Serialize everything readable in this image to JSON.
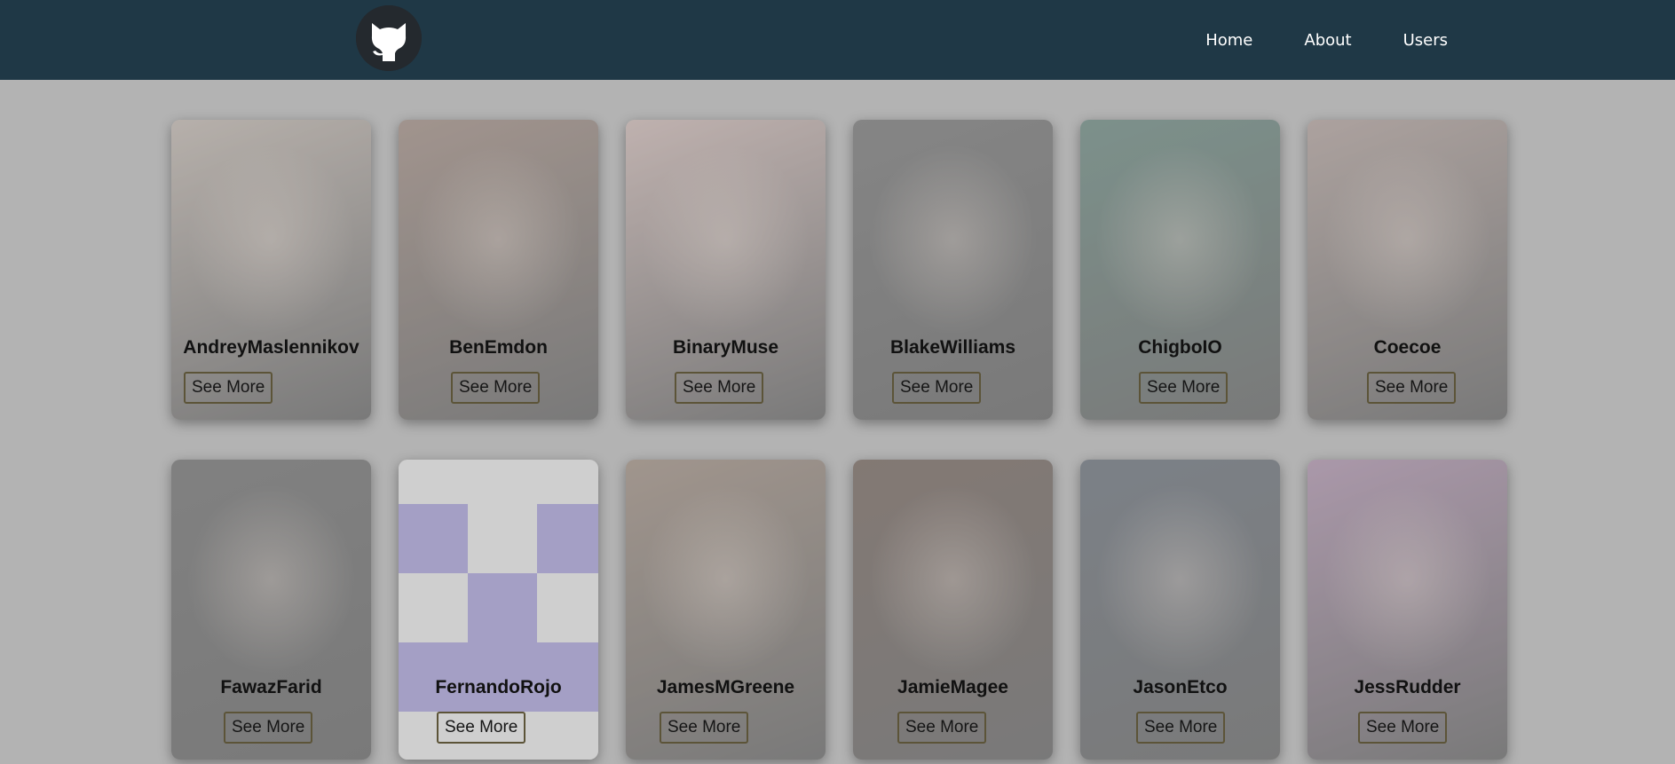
{
  "navbar": {
    "logo_icon": "github-octocat-icon",
    "links": [
      "Home",
      "About",
      "Users"
    ]
  },
  "users": [
    {
      "login": "AndreyMaslennikov",
      "button": "See More",
      "avatar": "photo",
      "tone": "#c9bfb7"
    },
    {
      "login": "BenEmdon",
      "button": "See More",
      "avatar": "photo",
      "tone": "#a8948a"
    },
    {
      "login": "BinaryMuse",
      "button": "See More",
      "avatar": "illustration",
      "tone": "#d6c1bd"
    },
    {
      "login": "BlakeWilliams",
      "button": "See More",
      "avatar": "photo",
      "tone": "#7d7d7d"
    },
    {
      "login": "ChigboIO",
      "button": "See More",
      "avatar": "photo",
      "tone": "#6f8f86"
    },
    {
      "login": "Coecoe",
      "button": "See More",
      "avatar": "photo",
      "tone": "#b9a9a4"
    },
    {
      "login": "FawazFarid",
      "button": "See More",
      "avatar": "photo",
      "tone": "#767676"
    },
    {
      "login": "FernandoRojo",
      "button": "See More",
      "avatar": "identicon",
      "tone": "#a49fc5"
    },
    {
      "login": "JamesMGreene",
      "button": "See More",
      "avatar": "photo",
      "tone": "#a79689"
    },
    {
      "login": "JamieMagee",
      "button": "See More",
      "avatar": "photo",
      "tone": "#7a6a62"
    },
    {
      "login": "JasonEtco",
      "button": "See More",
      "avatar": "photo",
      "tone": "#6e7680"
    },
    {
      "login": "JessRudder",
      "button": "See More",
      "avatar": "photo",
      "tone": "#b69ab5"
    }
  ]
}
